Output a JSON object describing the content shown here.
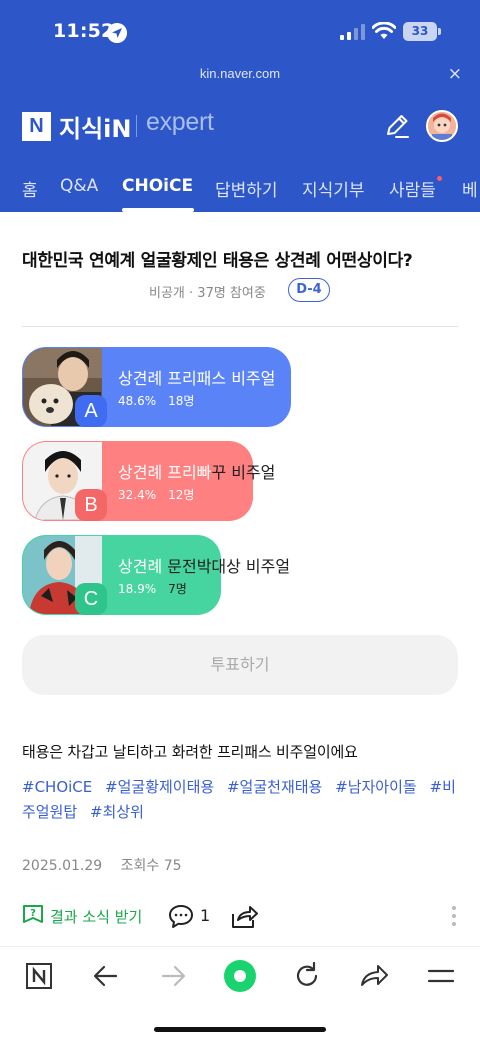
{
  "status": {
    "time": "11:52",
    "battery": "33"
  },
  "browser": {
    "url": "kin.naver.com",
    "close": "×"
  },
  "header": {
    "logo": "N",
    "brand": "지식iN",
    "expert": "expert",
    "nav": [
      {
        "label": "홈"
      },
      {
        "label": "Q&A"
      },
      {
        "label": "CHOiCE"
      },
      {
        "label": "답변하기"
      },
      {
        "label": "지식기부"
      },
      {
        "label": "사람들"
      },
      {
        "label": "베"
      }
    ]
  },
  "question": {
    "title": "대한민국 연예계 얼굴황제인 태용은 상견례 어떤상이다?",
    "visibility": "비공개",
    "participants": "37명 참여중",
    "dday": "D-4"
  },
  "options": [
    {
      "letter": "A",
      "label_in": "상견례 프리패스 비주얼",
      "label_out": "",
      "percent": "48.6%",
      "votes": "18명",
      "share": 0.486,
      "color": "#5a83f7",
      "badge": "#3f6cf0"
    },
    {
      "letter": "B",
      "label_in": "상견례 프리빠",
      "label_out": "꾸 비주얼",
      "percent": "32.4%",
      "votes": "12명",
      "share": 0.324,
      "color": "#ff8080",
      "badge": "#f46767"
    },
    {
      "letter": "C",
      "label_in": "상견례 ",
      "label_out": "문전박대상 비주얼",
      "percent": "18.9%",
      "votes": "7명",
      "share": 0.189,
      "color": "#46d4a0",
      "badge": "#2fc48c"
    }
  ],
  "vote_button": "투표하기",
  "body": "태용은 차갑고 날티하고 화려한 프리패스 비주얼이에요",
  "tags": [
    "#CHOiCE",
    "#얼굴황제이태용",
    "#얼굴천재태용",
    "#남자아이돌",
    "#비주얼원탑",
    "#최상위"
  ],
  "date": "2025.01.29",
  "views": "조회수 75",
  "actions": {
    "result_label": "결과 소식 받기",
    "comment_count": "1"
  },
  "icons": [
    "location-arrow-icon",
    "signal-icon",
    "wifi-icon",
    "battery-icon",
    "pen-icon",
    "avatar",
    "bell-question-icon",
    "comment-icon",
    "share-icon",
    "more-icon",
    "naver-home-icon",
    "back-icon",
    "forward-icon",
    "green-dot-icon",
    "reload-icon",
    "share-arrow-icon",
    "menu-icon"
  ]
}
